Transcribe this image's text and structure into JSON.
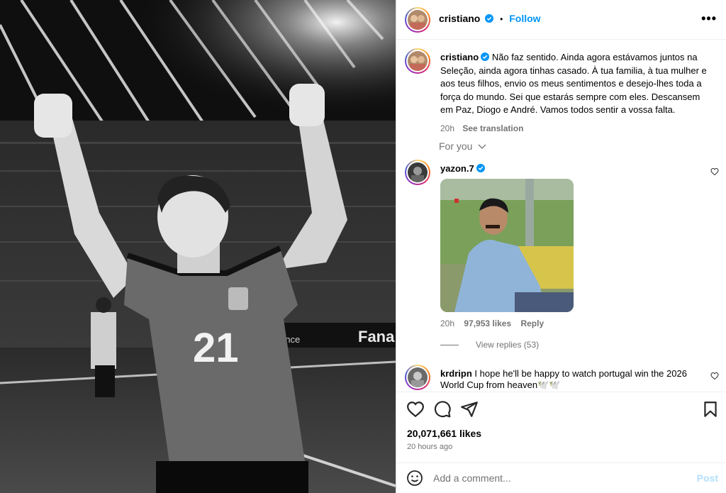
{
  "post": {
    "author": "cristiano",
    "follow_label": "Follow",
    "separator": "•",
    "more_label": "•••"
  },
  "caption": {
    "username": "cristiano",
    "text": "Não faz sentido. Ainda agora estávamos juntos na Seleção, ainda agora tinhas casado. À tua familia, à tua mulher e aos teus filhos, envio os meus sentimentos e desejo-lhes toda a força do mundo. Sei que estarás sempre com eles. Descansem em Paz, Diogo e André. Vamos todos sentir a vossa falta.",
    "time": "20h",
    "see_translation": "See translation"
  },
  "for_you_label": "For you",
  "comments": [
    {
      "username": "yazon.7",
      "verified": true,
      "time": "20h",
      "likes": "97,953 likes",
      "reply_label": "Reply",
      "view_replies": "View replies (53)"
    },
    {
      "username": "krdripn",
      "verified": false,
      "text": "I hope he'll be happy to watch portugal win the 2026 World Cup from heaven🕊️🕊️"
    }
  ],
  "photo": {
    "jersey_number": "21",
    "ad_board_text": "Fana",
    "ad_board_text_2": "ance"
  },
  "stats": {
    "likes": "20,071,661 likes",
    "ago": "20 hours ago"
  },
  "add_comment": {
    "placeholder": "Add a comment...",
    "post_label": "Post"
  },
  "colors": {
    "accent": "#0095f6",
    "muted": "#737373",
    "post_disabled": "#b2dffc"
  },
  "icons": [
    "heart-icon",
    "comment-icon",
    "share-icon",
    "bookmark-icon",
    "emoji-icon",
    "verified-icon",
    "chevron-down-icon",
    "more-icon"
  ]
}
